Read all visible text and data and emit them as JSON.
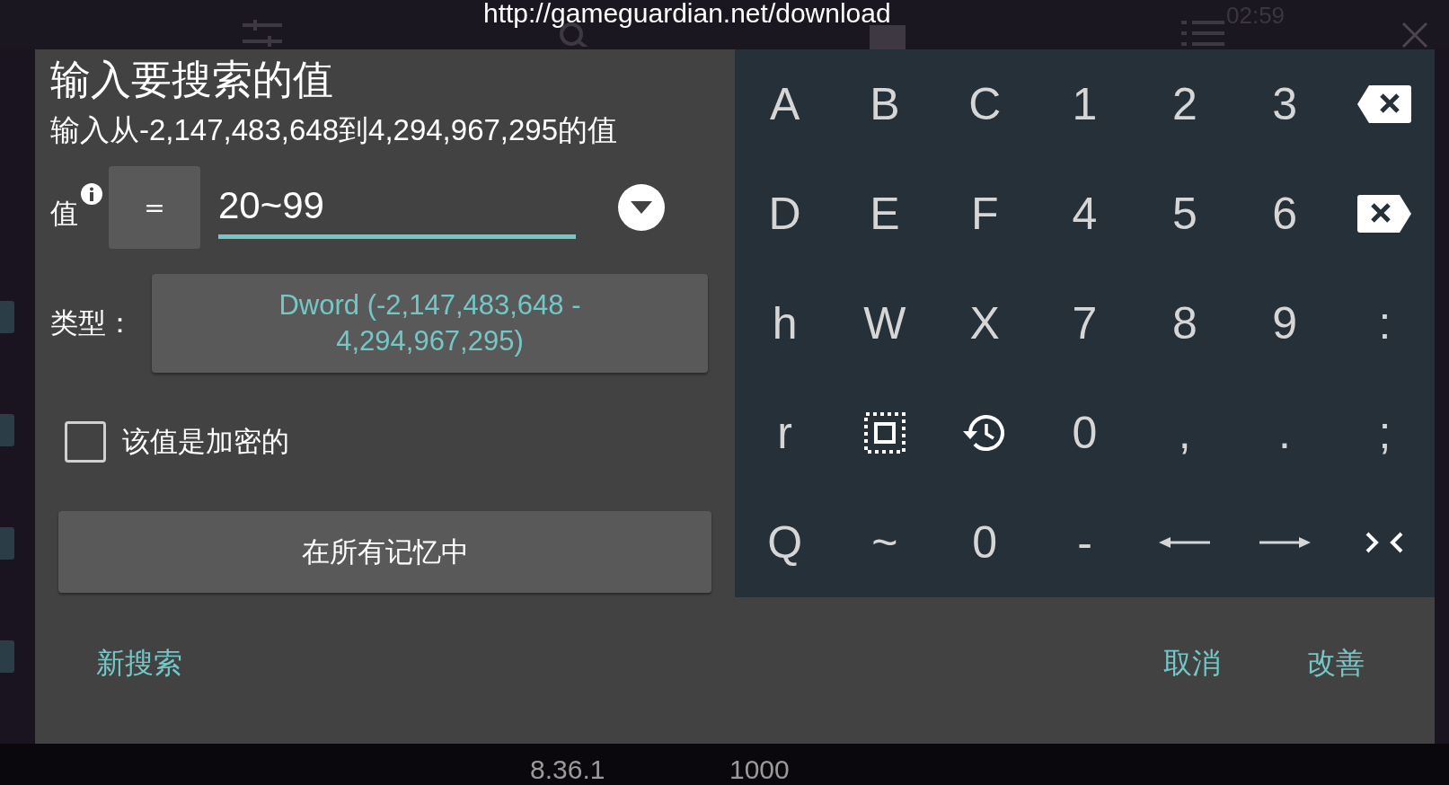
{
  "status_bar": {
    "url": "http://gameguardian.net/download",
    "time": "02:59"
  },
  "dialog": {
    "title": "输入要搜索的值",
    "subtitle": "输入从-2,147,483,648到4,294,967,295的值",
    "value_label": "值",
    "operator": "=",
    "value": "20~99",
    "type_label": "类型：",
    "type_value": "Dword (-2,147,483,648 - 4,294,967,295)",
    "encrypted": {
      "label": "该值是加密的",
      "checked": false
    },
    "region_button": "在所有记忆中",
    "actions": {
      "new_search": "新搜索",
      "cancel": "取消",
      "refine": "改善"
    }
  },
  "keyboard": {
    "keys": [
      {
        "kind": "char",
        "label": "A"
      },
      {
        "kind": "char",
        "label": "B"
      },
      {
        "kind": "char",
        "label": "C"
      },
      {
        "kind": "char",
        "label": "1"
      },
      {
        "kind": "char",
        "label": "2"
      },
      {
        "kind": "char",
        "label": "3"
      },
      {
        "kind": "backspace"
      },
      {
        "kind": "char",
        "label": "D"
      },
      {
        "kind": "char",
        "label": "E"
      },
      {
        "kind": "char",
        "label": "F"
      },
      {
        "kind": "char",
        "label": "4"
      },
      {
        "kind": "char",
        "label": "5"
      },
      {
        "kind": "char",
        "label": "6"
      },
      {
        "kind": "delete"
      },
      {
        "kind": "char",
        "label": "h"
      },
      {
        "kind": "char",
        "label": "W"
      },
      {
        "kind": "char",
        "label": "X"
      },
      {
        "kind": "char",
        "label": "7"
      },
      {
        "kind": "char",
        "label": "8"
      },
      {
        "kind": "char",
        "label": "9"
      },
      {
        "kind": "char",
        "label": ":"
      },
      {
        "kind": "char",
        "label": "r"
      },
      {
        "kind": "select"
      },
      {
        "kind": "history"
      },
      {
        "kind": "char",
        "label": "0"
      },
      {
        "kind": "char",
        "label": ","
      },
      {
        "kind": "char",
        "label": "."
      },
      {
        "kind": "char",
        "label": ";"
      },
      {
        "kind": "char",
        "label": "Q"
      },
      {
        "kind": "char",
        "label": "~"
      },
      {
        "kind": "char",
        "label": "0"
      },
      {
        "kind": "char",
        "label": "-"
      },
      {
        "kind": "left"
      },
      {
        "kind": "right"
      },
      {
        "kind": "collapse"
      }
    ]
  },
  "footer": {
    "version": "8.36.1",
    "count": "1000"
  }
}
